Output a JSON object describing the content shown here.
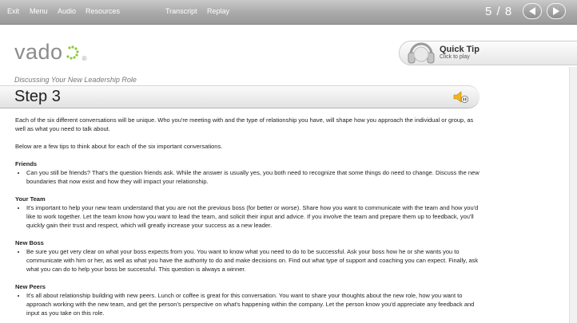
{
  "nav": {
    "exit": "Exit",
    "menu": "Menu",
    "audio": "Audio",
    "resources": "Resources",
    "transcript": "Transcript",
    "replay": "Replay",
    "page_indicator": "5 / 8"
  },
  "logo": {
    "text": "vado",
    "registered": "®"
  },
  "quick_tip": {
    "title": "Quick Tip",
    "subtitle": "Click to play"
  },
  "subtitle": "Discussing Your New Leadership Role",
  "step_title": "Step 3",
  "content": {
    "intro": "Each of the six different conversations will be unique. Who you're meeting with and the type of relationship you have, will shape how you approach the individual or group, as well as what you need to talk about.",
    "intro2": "Below are a few tips to think about for each of the six important conversations.",
    "sections": [
      {
        "heading": "Friends",
        "text": "Can you still be friends? That's the question friends ask. While the answer is usually yes, you both need to recognize that some things do need to change. Discuss the new boundaries that now exist and how they will impact your relationship."
      },
      {
        "heading": "Your Team",
        "text": "It's important to help your new team understand that you are not the previous boss (for better or worse). Share how you want to communicate with the team and how you'd like to work together. Let the team know how you want to lead the team, and solicit their input and advice. If you involve the team and prepare them up to feedback, you'll quickly gain their trust and respect, which will greatly increase your success as a new leader."
      },
      {
        "heading": "New Boss",
        "text": "Be sure you get very clear on what your boss expects from you. You want to know what you need to do to be successful. Ask your boss how he or she wants you to communicate with him or her, as well as what you have the authority to do and make decisions on. Find out what type of support and coaching you can expect. Finally, ask what you can do to help your boss be successful. This question is always a winner."
      },
      {
        "heading": "New Peers",
        "text": "It's all about relationship building with new peers. Lunch or coffee is great for this conversation. You want to share your thoughts about the new role, how you want to approach working with the new team, and get the person's perspective on what's happening within the company. Let the person know you'd appreciate any feedback and input as you take on this role."
      }
    ]
  },
  "icons": {
    "prev": "chevron-left-icon",
    "next": "chevron-right-icon",
    "quick_tip": "headphones-icon",
    "audio": "speaker-icon"
  },
  "colors": {
    "topbar": "#a9a9a9",
    "logo_dots": "#8cc63f"
  }
}
